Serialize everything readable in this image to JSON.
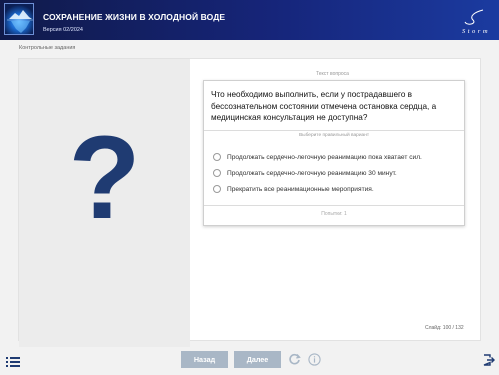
{
  "header": {
    "title": "СОХРАНЕНИЕ ЖИЗНИ В ХОЛОДНОЙ ВОДЕ",
    "version": "Версия 02/2024",
    "brand_text": "Storm",
    "logo_icon": "iceberg-logo",
    "colors": {
      "bar_start": "#101a4a",
      "bar_end": "#1b3ba0"
    }
  },
  "breadcrumb": "Контрольные задания",
  "question": {
    "label": "Текст вопроса",
    "text": "Что необходимо выполнить, если у пострадавшего в бессознательном состоянии отмечена остановка сердца, а медицинская консультация не доступна?",
    "instruction": "Выберите правильный вариант",
    "options": [
      {
        "label": "Продолжать сердечно-легочную реанимацию пока хватает сил.",
        "selected": false
      },
      {
        "label": "Продолжать сердечно-легочную реанимацию 30 минут.",
        "selected": false
      },
      {
        "label": "Прекратить все реанимационные мероприятия.",
        "selected": false
      }
    ],
    "attempts": "Попытки: 1",
    "illustration_symbol": "?"
  },
  "slide_counter": "Слайд: 100 / 132",
  "footer": {
    "back_label": "Назад",
    "next_label": "Далее",
    "icons": [
      "menu-icon",
      "reload-icon",
      "info-icon",
      "exit-icon"
    ],
    "button_color": "#a9b7c6"
  }
}
